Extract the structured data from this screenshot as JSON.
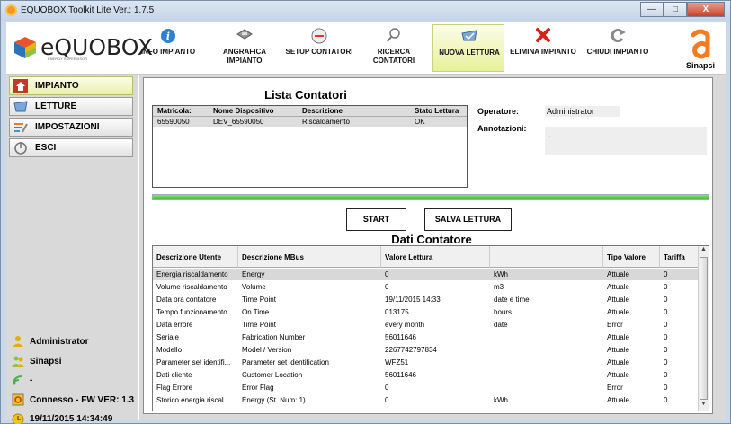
{
  "window": {
    "title": "EQUOBOX Toolkit Lite Ver.: 1.7.5",
    "minimize": "—",
    "maximize": "□",
    "close": "X"
  },
  "logo": {
    "text": "eQUOBOX",
    "sub": "ENERGY SUPERVISOR"
  },
  "toolbar": [
    {
      "label": "INFO IMPIANTO",
      "icon": "info-icon"
    },
    {
      "label": "ANGRAFICA IMPIANTO",
      "icon": "registry-icon"
    },
    {
      "label": "SETUP CONTATORI",
      "icon": "setup-icon"
    },
    {
      "label": "RICERCA CONTATORI",
      "icon": "search-icon"
    },
    {
      "label": "NUOVA LETTURA",
      "icon": "new-reading-icon",
      "active": true
    },
    {
      "label": "ELIMINA IMPIANTO",
      "icon": "delete-icon"
    },
    {
      "label": "CHIUDI IMPIANTO",
      "icon": "close-plant-icon"
    }
  ],
  "brand_right": "Sinapsi",
  "sidebar": {
    "items": [
      {
        "label": "IMPIANTO",
        "icon": "home-icon",
        "active": true
      },
      {
        "label": "LETTURE",
        "icon": "readings-icon"
      },
      {
        "label": "IMPOSTAZIONI",
        "icon": "settings-icon"
      },
      {
        "label": "ESCI",
        "icon": "exit-icon"
      }
    ],
    "status": [
      {
        "label": "Administrator",
        "icon": "user-icon"
      },
      {
        "label": "Sinapsi",
        "icon": "users-icon"
      },
      {
        "label": "-",
        "icon": "signal-icon"
      },
      {
        "label": "Connesso - FW VER: 1.3",
        "icon": "connection-icon"
      },
      {
        "label": "19/11/2015 14:34:49",
        "icon": "clock-icon"
      }
    ]
  },
  "meters": {
    "title": "Lista Contatori",
    "headers": [
      "Matricola:",
      "Nome Dispositivo",
      "Descrizione",
      "Stato Lettura"
    ],
    "rows": [
      [
        "65590050",
        "DEV_65590050",
        "Riscaldamento",
        "OK"
      ]
    ]
  },
  "operator": {
    "label": "Operatore:",
    "value": "Administrator"
  },
  "notes": {
    "label": "Annotazioni:",
    "value": "-"
  },
  "progress": 1.0,
  "buttons": {
    "start": "START",
    "save": "SALVA LETTURA"
  },
  "data": {
    "title": "Dati Contatore",
    "headers": [
      "Descrizione Utente",
      "Descrizione MBus",
      "Valore Lettura",
      "",
      "Tipo Valore",
      "Tariffa"
    ],
    "rows": [
      [
        "Energia riscaldamento",
        "Energy",
        "0",
        "kWh",
        "Attuale",
        "0"
      ],
      [
        "Volume riscaldamento",
        "Volume",
        "0",
        "m3",
        "Attuale",
        "0"
      ],
      [
        "Data ora contatore",
        "Time Point",
        "19/11/2015 14:33",
        "date e time",
        "Attuale",
        "0"
      ],
      [
        "Tempo funzionamento",
        "On Time",
        "013175",
        "hours",
        "Attuale",
        "0"
      ],
      [
        "Data errore",
        "Time Point",
        "every month",
        "date",
        "Error",
        "0"
      ],
      [
        "Seriale",
        "Fabrication Number",
        "56011646",
        "",
        "Attuale",
        "0"
      ],
      [
        "Modello",
        "Model / Version",
        "2267742797834",
        "",
        "Attuale",
        "0"
      ],
      [
        "Parameter set identifi...",
        "Parameter set identification",
        "WFZ51",
        "",
        "Attuale",
        "0"
      ],
      [
        "Dati cliente",
        "Customer Location",
        "56011646",
        "",
        "Attuale",
        "0"
      ],
      [
        "Flag Errore",
        "Error Flag",
        "0",
        "",
        "Error",
        "0"
      ],
      [
        "Storico energia riscal...",
        "Energy (St. Num: 1)",
        "0",
        "kWh",
        "Attuale",
        "0"
      ]
    ]
  }
}
